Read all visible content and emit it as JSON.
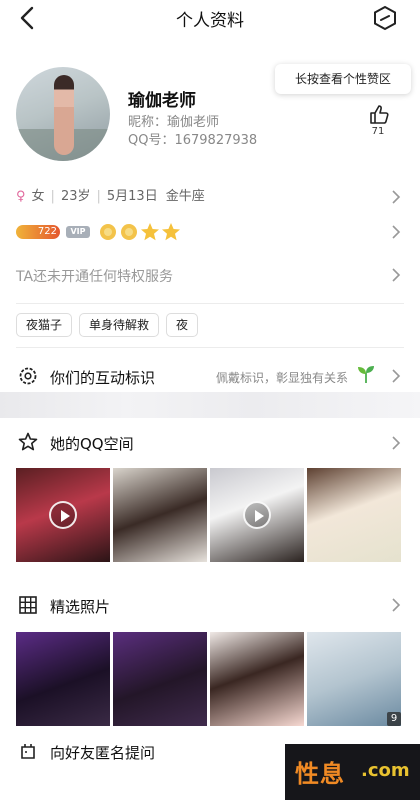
{
  "header": {
    "title": "个人资料",
    "back_icon": "chevron-left-icon",
    "menu_icon": "hexagon-icon"
  },
  "profile": {
    "display_name": "瑜伽老师",
    "nickname_line": "昵称：瑜伽老师",
    "qq_line": "QQ号：1679827938",
    "like_tip": "长按查看个性赞区",
    "like_count": "71"
  },
  "info": {
    "gender": "女",
    "age": "23岁",
    "birthday": "5月13日",
    "zodiac": "金牛座"
  },
  "badges": {
    "coin_value": "722",
    "vip_label": "VIP"
  },
  "privilege_text": "TA还未开通任何特权服务",
  "tags": [
    "夜猫子",
    "单身待解救",
    "夜"
  ],
  "interaction": {
    "title": "你们的互动标识",
    "note": "佩戴标识，彰显独有关系"
  },
  "qzone": {
    "title": "她的QQ空间"
  },
  "selected_photos": {
    "title": "精选照片",
    "count_badge": "9"
  },
  "ask": {
    "title": "向好友匿名提问"
  },
  "watermark": {
    "text_a": "性息",
    "text_b": ".com"
  },
  "colors": {
    "female": "#e0679c",
    "coin": "#f0b33a",
    "watermark_orange": "#f08a24"
  }
}
